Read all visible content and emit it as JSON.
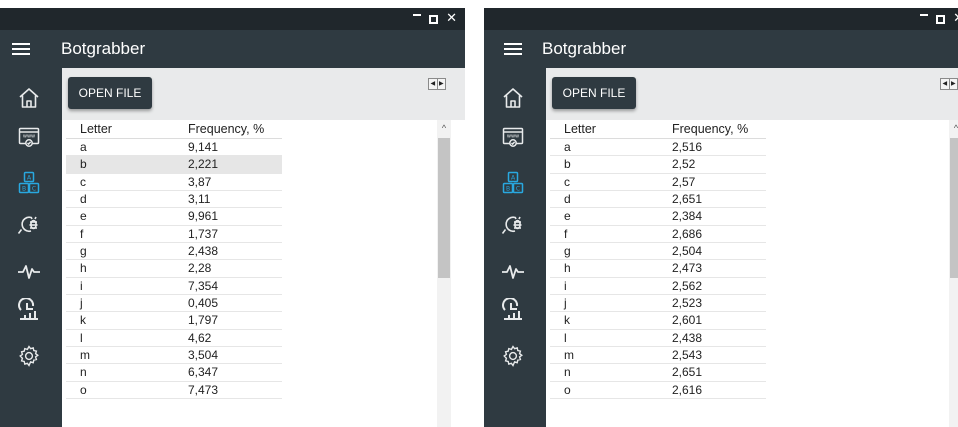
{
  "windows": [
    {
      "app_title": "Botgrabber",
      "open_file_label": "OPEN FILE",
      "columns": [
        "Letter",
        "Frequency, %"
      ],
      "selected_row": 1,
      "rows": [
        [
          "a",
          "9,141"
        ],
        [
          "b",
          "2,221"
        ],
        [
          "c",
          "3,87"
        ],
        [
          "d",
          "3,11"
        ],
        [
          "e",
          "9,961"
        ],
        [
          "f",
          "1,737"
        ],
        [
          "g",
          "2,438"
        ],
        [
          "h",
          "2,28"
        ],
        [
          "i",
          "7,354"
        ],
        [
          "j",
          "0,405"
        ],
        [
          "k",
          "1,797"
        ],
        [
          "l",
          "4,62"
        ],
        [
          "m",
          "3,504"
        ],
        [
          "n",
          "6,347"
        ],
        [
          "o",
          "7,473"
        ]
      ]
    },
    {
      "app_title": "Botgrabber",
      "open_file_label": "OPEN FILE",
      "columns": [
        "Letter",
        "Frequency, %"
      ],
      "selected_row": -1,
      "rows": [
        [
          "a",
          "2,516"
        ],
        [
          "b",
          "2,52"
        ],
        [
          "c",
          "2,57"
        ],
        [
          "d",
          "2,651"
        ],
        [
          "e",
          "2,384"
        ],
        [
          "f",
          "2,686"
        ],
        [
          "g",
          "2,504"
        ],
        [
          "h",
          "2,473"
        ],
        [
          "i",
          "2,562"
        ],
        [
          "j",
          "2,523"
        ],
        [
          "k",
          "2,601"
        ],
        [
          "l",
          "2,438"
        ],
        [
          "m",
          "2,543"
        ],
        [
          "n",
          "2,651"
        ],
        [
          "o",
          "2,616"
        ]
      ]
    }
  ],
  "nav_items": [
    "home-icon",
    "web-page-icon",
    "blocks-icon",
    "bug-search-icon",
    "pulse-icon",
    "statistics-icon",
    "settings-icon"
  ],
  "colors": {
    "chrome": "#2f3a41",
    "titlebar": "#20272c",
    "accent": "#29a8e0",
    "toolbar": "#e9eaeb"
  }
}
